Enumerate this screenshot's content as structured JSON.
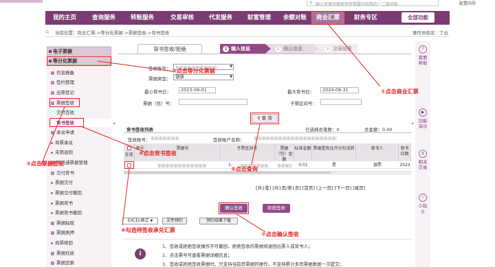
{
  "search": {
    "placeholder": "输入关键词搜索你所需要的权限的一二级功能"
  },
  "top_link": "配置向导",
  "nav": [
    {
      "label": "我的主页"
    },
    {
      "label": "查询服务"
    },
    {
      "label": "转账服务"
    },
    {
      "label": "交易审核"
    },
    {
      "label": "代发服务"
    },
    {
      "label": "财富管理"
    },
    {
      "label": "余额对账"
    },
    {
      "label": "商业汇票",
      "active": true
    },
    {
      "label": "财务专区"
    }
  ],
  "all_functions": "全部功能",
  "breadcrumb": "当前位置：商业汇票->等分化票据->票据签收->背书签收",
  "operator": "操作员姓名：丁云",
  "sidebar": {
    "headers": [
      "电子票据",
      "等分化票据"
    ],
    "items": [
      {
        "label": "信息报备",
        "type": "icon"
      },
      {
        "label": "签约管理",
        "type": "icon"
      },
      {
        "label": "出票登记",
        "type": "icon"
      },
      {
        "label": "票据签收",
        "type": "icon"
      },
      {
        "label": "交付签收",
        "type": "sub"
      },
      {
        "label": "背书签收",
        "type": "sub",
        "active": true
      },
      {
        "label": "承兑申请",
        "type": "icon"
      },
      {
        "label": "商票承兑",
        "type": "dot"
      },
      {
        "label": "未用退回",
        "type": "dot"
      },
      {
        "label": "可流通票据管理",
        "type": "icon"
      },
      {
        "label": "交付背书",
        "type": "icon"
      },
      {
        "label": "票据交付",
        "type": "dot"
      },
      {
        "label": "票据交付撤回",
        "type": "dot"
      },
      {
        "label": "票据背书",
        "type": "dot"
      },
      {
        "label": "票据背书撤回",
        "type": "dot"
      },
      {
        "label": "票据贴现",
        "type": "icon"
      },
      {
        "label": "票据质押",
        "type": "icon"
      },
      {
        "label": "商票赎回",
        "type": "dot"
      },
      {
        "label": "票据托收",
        "type": "icon"
      },
      {
        "label": "票据追索",
        "type": "icon"
      }
    ]
  },
  "tab": "背书签收/拒绝",
  "steps": [
    {
      "num": "1",
      "label": "输入信息"
    },
    {
      "num": "2",
      "label": "确认信息"
    },
    {
      "num": "3",
      "label": "交易结果"
    }
  ],
  "form": {
    "account_label": "签收账号：",
    "bill_type_label": "票据类型：",
    "bill_type_value": "银票",
    "min_issue_label": "最小背书日：",
    "min_issue_value": "2023-09-01",
    "max_issue_label": "最大背书日：",
    "max_issue_value": "2024-08-31",
    "bill_no_label": "票据（包）号：",
    "sub_range_label": "子票区间号："
  },
  "query_button": "查 询",
  "list": {
    "title": "背书签收列表",
    "selected_count": "已选择总笔数：0",
    "total_amount": "总金额：0.00",
    "account_label": "签收账号：",
    "account_user_label": "签收账户名称："
  },
  "table": {
    "headers": [
      "全选",
      "序号",
      "票据号",
      "子票区间号",
      "票据（包）金额",
      "标准金额",
      "票据是否允许分包流转",
      "背书人",
      "背书日期"
    ],
    "row": {
      "sub_range": "1-",
      "amount": "",
      "std_amount": "0.01",
      "splittable": "是",
      "endorser": "银票",
      "date": "2024"
    }
  },
  "pagination": "[共1笔] [共1页/第1页] [首页] [上一页] [下一页] [尾页]",
  "buttons": {
    "confirm_sign": "确认签收",
    "reject_sign": "拒绝签收",
    "excel_select": "EXCEL格式",
    "file_preview": "文件预约",
    "preview_download": "预约结果下载"
  },
  "notes": [
    "1、签收或拒绝签收操作不可撤回，拒绝签收的票据将退回出票人或背书人；",
    "2、点击票号可查看票据详细信息；",
    "3、签收或拒绝签收票据时，只支持当前页票据的操作，不支持累计多页票据数据一次提交；"
  ],
  "right_bar": [
    {
      "icon": "?",
      "label": "需要帮助"
    },
    {
      "icon": "▶",
      "label": "功能演示"
    },
    {
      "icon": "$",
      "label": "相关交易"
    },
    {
      "icon": "i",
      "label": "小贴士"
    }
  ],
  "annotations": [
    {
      "text": "①点击商业汇票"
    },
    {
      "text": "②点击等分化票据"
    },
    {
      "text": "③点击票据签收"
    },
    {
      "text": "④点击背书签收"
    },
    {
      "text": "⑤点击查询"
    },
    {
      "text": "⑥勾选待签收承兑汇票"
    },
    {
      "text": "⑦点击确认签收"
    }
  ],
  "colors": {
    "brand": "#7a3c72",
    "active_nav": "#a7739d",
    "annotation": "#e62020"
  }
}
